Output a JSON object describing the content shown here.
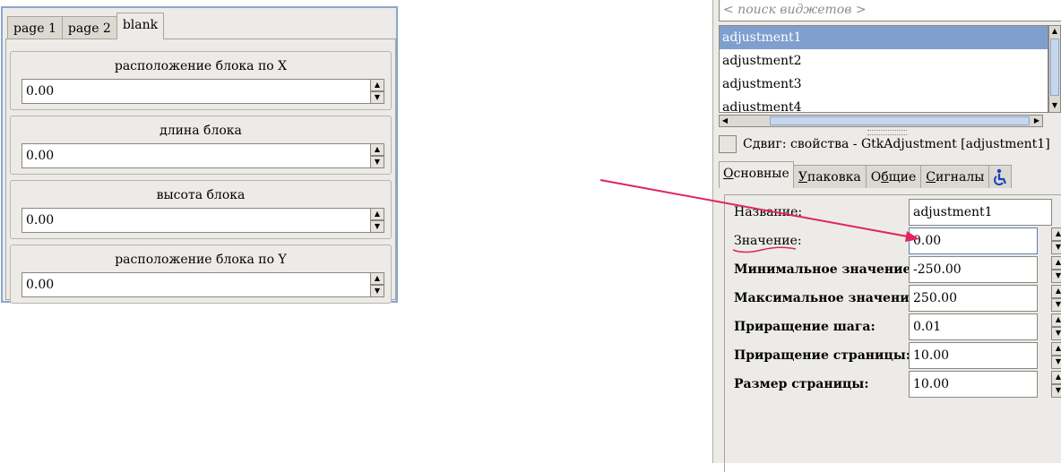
{
  "preview": {
    "tabs": [
      "page 1",
      "page 2",
      "blank"
    ],
    "active_tab": "blank",
    "fields": [
      {
        "label": "расположение блока по X",
        "value": "0.00"
      },
      {
        "label": "длина блока",
        "value": "0.00"
      },
      {
        "label": "высота блока",
        "value": "0.00"
      },
      {
        "label": "расположение блока по Y",
        "value": "0.00"
      }
    ]
  },
  "inspector": {
    "search_placeholder": "< поиск виджетов >",
    "widgets": [
      "adjustment1",
      "adjustment2",
      "adjustment3",
      "adjustment4"
    ],
    "selected_widget": "adjustment1",
    "properties_title": "Сдвиг: свойства - GtkAdjustment [adjustment1]",
    "tabs": [
      {
        "label": "Основные",
        "mnemonic": "О",
        "rest": "сновные"
      },
      {
        "label": "Упаковка",
        "mnemonic": "У",
        "rest": "паковка"
      },
      {
        "label": "Общие",
        "pre": "О",
        "mnemonic": "б",
        "rest": "щие"
      },
      {
        "label": "Сигналы",
        "mnemonic": "С",
        "rest": "игналы"
      }
    ],
    "accessibility_icon": "accessibility-icon",
    "properties": [
      {
        "label": "Название:",
        "value": "adjustment1",
        "bold": false,
        "spin": false
      },
      {
        "label": "Значение:",
        "value": "0.00",
        "bold": false,
        "spin": true
      },
      {
        "label": "Минимальное значение:",
        "value": "-250.00",
        "bold": true,
        "spin": true
      },
      {
        "label": "Максимальное значение:",
        "value": "250.00",
        "bold": true,
        "spin": true
      },
      {
        "label": "Приращение шага:",
        "value": "0.01",
        "bold": true,
        "spin": true
      },
      {
        "label": "Приращение страницы:",
        "value": "10.00",
        "bold": true,
        "spin": true
      },
      {
        "label": "Размер страницы:",
        "value": "10.00",
        "bold": true,
        "spin": true
      }
    ]
  },
  "annotation": {
    "arrow_color": "#e0245e",
    "arrow_points_to": "Значение"
  },
  "colors": {
    "selection": "#7f9fcf",
    "window_border": "#8aa5cf",
    "annotation": "#e0245e"
  }
}
